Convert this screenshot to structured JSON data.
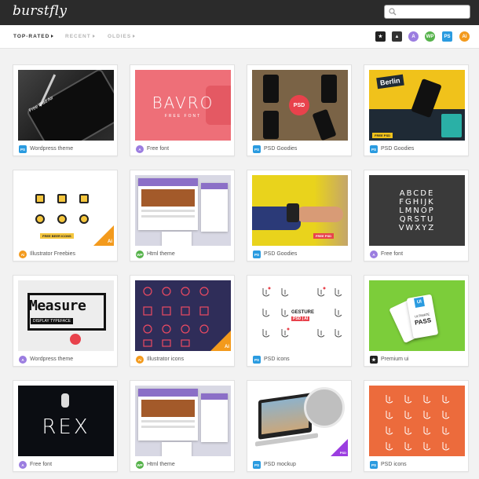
{
  "header": {
    "logo": "burstfly",
    "search_placeholder": ""
  },
  "filters": {
    "tabs": [
      "TOP-RATED",
      "RECENT",
      "OLDIES"
    ],
    "active": "TOP-RATED",
    "icons": [
      {
        "name": "premium-star-filter-icon",
        "label": "★",
        "color": "#222222"
      },
      {
        "name": "photo-filter-icon",
        "label": "▲",
        "color": "#333333"
      },
      {
        "name": "font-filter-icon",
        "label": "A",
        "color": "#9b7de0"
      },
      {
        "name": "wordpress-filter-icon",
        "label": "WP",
        "color": "#55b24a"
      },
      {
        "name": "psd-filter-icon",
        "label": "PS",
        "color": "#2a9be0"
      },
      {
        "name": "illustrator-filter-icon",
        "label": "Ai",
        "color": "#f39a1c"
      }
    ]
  },
  "cards": [
    {
      "badge": "PS",
      "badge_type": "ps",
      "label": "Wordpress theme",
      "thumb": "ipad"
    },
    {
      "badge": "A",
      "badge_type": "a",
      "label": "Free font",
      "thumb": "bavro"
    },
    {
      "badge": "PS",
      "badge_type": "ps",
      "label": "PSD Goodies",
      "thumb": "phones"
    },
    {
      "badge": "PS",
      "badge_type": "ps",
      "label": "PSD Goodies",
      "thumb": "berlin"
    },
    {
      "badge": "Ai",
      "badge_type": "ai",
      "label": "Illustrator Freebies",
      "thumb": "beer"
    },
    {
      "badge": "WP",
      "badge_type": "wp",
      "label": "Html theme",
      "thumb": "html"
    },
    {
      "badge": "PS",
      "badge_type": "ps",
      "label": "PSD Goodies",
      "thumb": "watch"
    },
    {
      "badge": "A",
      "badge_type": "a",
      "label": "Free font",
      "thumb": "alphabet"
    },
    {
      "badge": "A",
      "badge_type": "a",
      "label": "Wordpress theme",
      "thumb": "measure"
    },
    {
      "badge": "Ai",
      "badge_type": "ai",
      "label": "Illustrator icons",
      "thumb": "icons"
    },
    {
      "badge": "PS",
      "badge_type": "ps",
      "label": "PSD icons",
      "thumb": "gesture"
    },
    {
      "badge": "★",
      "badge_type": "star",
      "label": "Premium ui",
      "thumb": "pass"
    },
    {
      "badge": "A",
      "badge_type": "a",
      "label": "Free font",
      "thumb": "rex"
    },
    {
      "badge": "WP",
      "badge_type": "wp",
      "label": "Html theme",
      "thumb": "html"
    },
    {
      "badge": "PS",
      "badge_type": "ps",
      "label": "PSD mockup",
      "thumb": "laptop"
    },
    {
      "badge": "PS",
      "badge_type": "ps",
      "label": "PSD icons",
      "thumb": "orange"
    }
  ],
  "thumb_text": {
    "bavro": "BAVRO",
    "bavro_sub": "FREE FONT",
    "psd_circle": "PSD",
    "berlin": "Berlin",
    "free_psd_tag": "FREE PSD",
    "beer_caption": "FREE BEER ICONS",
    "ai_corner": "Ai",
    "psd_corner": "PSD",
    "alphabet_lines": [
      "ABCDE",
      "FGHIJK",
      "LMNOP",
      "QRSTU",
      "VWXYZ"
    ],
    "measure_title": "Measure",
    "measure_sub": "DISPLAY TYPEFACE",
    "gesture_title": "GESTURE",
    "gesture_sub": "PSD | AI",
    "pass_line1": "ULTIMATE",
    "pass_line2": "PASS",
    "pass_ui": "UI",
    "rex": "REX",
    "ipad_text": "Free iPad Air"
  }
}
